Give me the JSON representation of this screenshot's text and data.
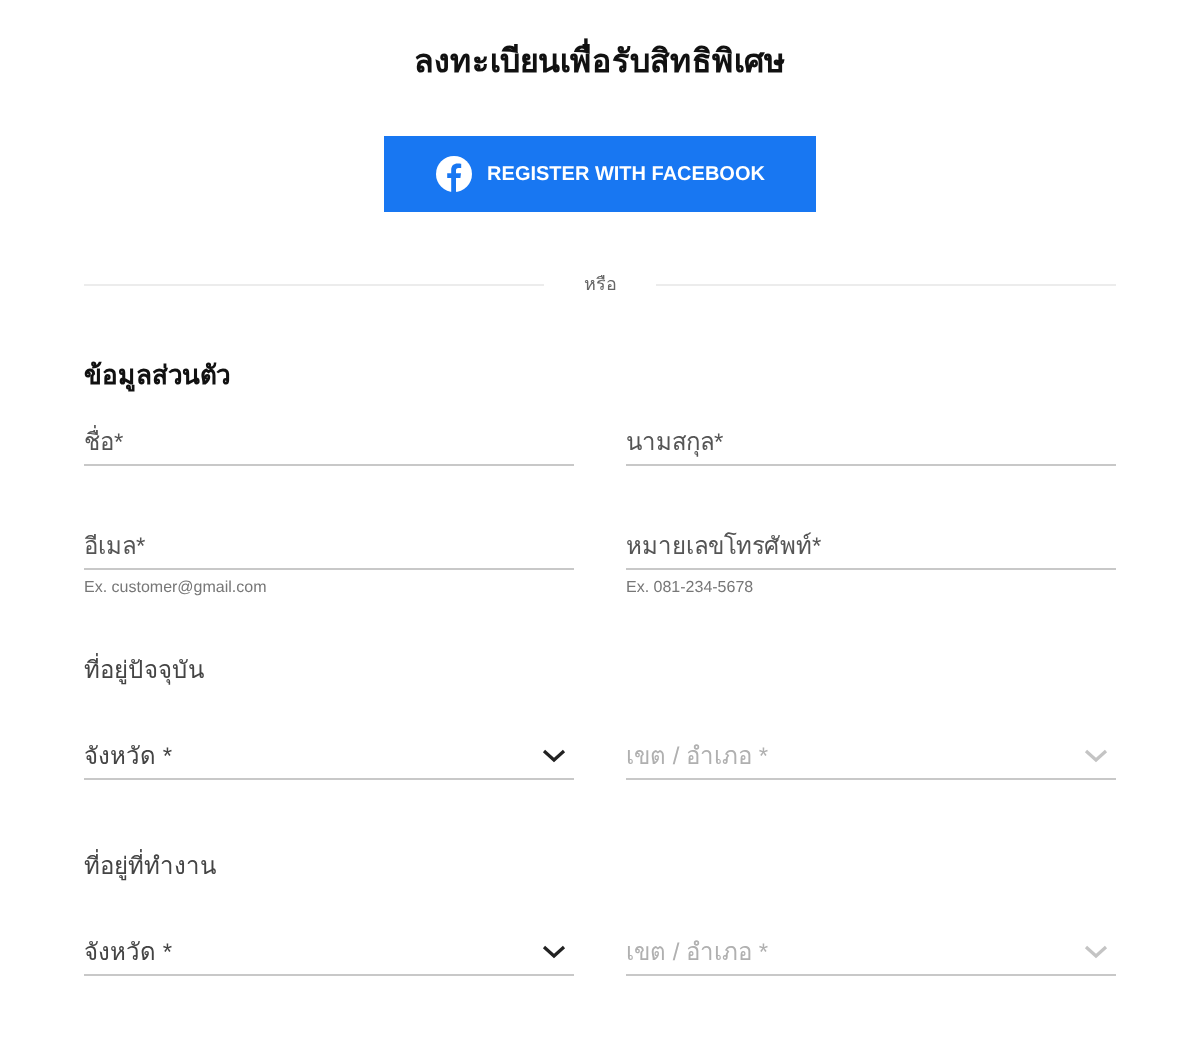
{
  "title": "ลงทะเบียนเพื่อรับสิทธิพิเศษ",
  "facebook_button": {
    "label": "REGISTER WITH FACEBOOK"
  },
  "divider": {
    "label": "หรือ"
  },
  "personal_section": {
    "heading": "ข้อมูลส่วนตัว",
    "fields": [
      {
        "placeholder": "ชื่อ*"
      },
      {
        "placeholder": "นามสกุล*"
      },
      {
        "placeholder": "อีเมล*",
        "helper": "Ex. customer@gmail.com"
      },
      {
        "placeholder": "หมายเลขโทรศัพท์*",
        "helper": "Ex. 081-234-5678"
      }
    ]
  },
  "address_sections": [
    {
      "heading": "ที่อยู่ปัจจุบัน",
      "selects": [
        {
          "placeholder": "จังหวัด *",
          "disabled": false
        },
        {
          "placeholder": "เขต / อำเภอ *",
          "disabled": true
        }
      ]
    },
    {
      "heading": "ที่อยู่ที่ทำงาน",
      "selects": [
        {
          "placeholder": "จังหวัด *",
          "disabled": false
        },
        {
          "placeholder": "เขต / อำเภอ *",
          "disabled": true
        }
      ]
    }
  ]
}
